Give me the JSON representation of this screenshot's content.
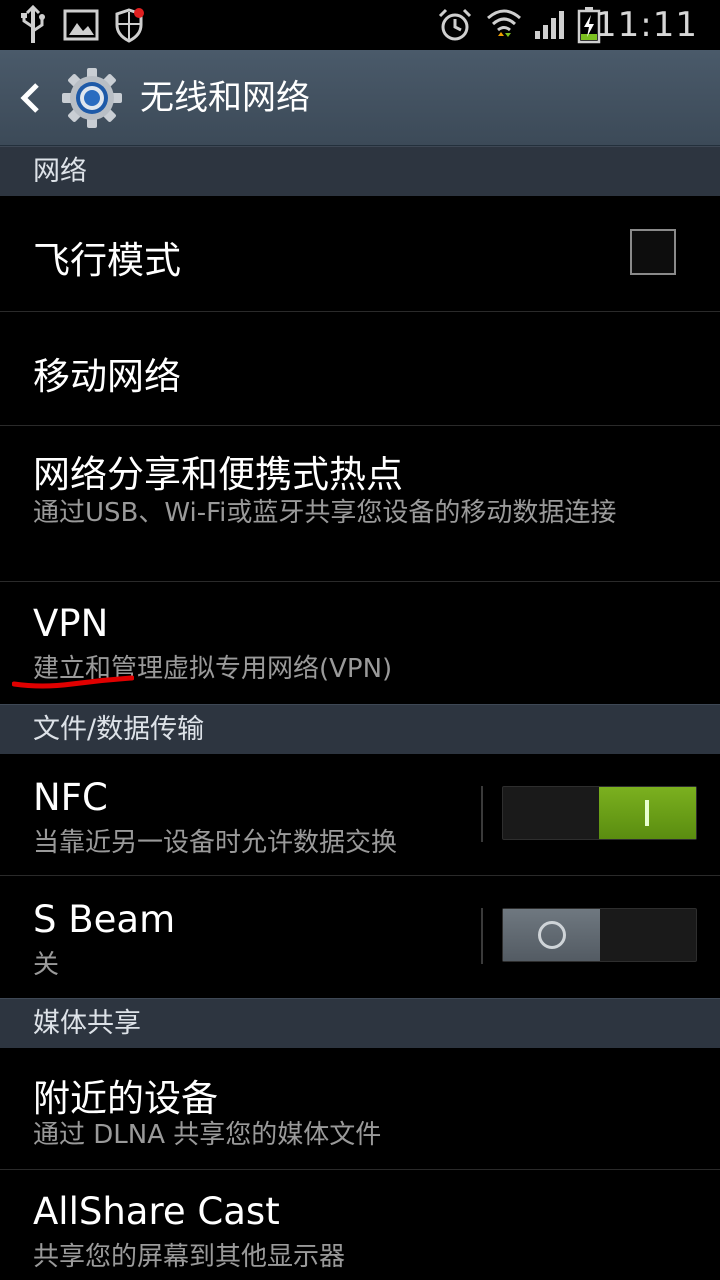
{
  "status_bar": {
    "time": "11:11",
    "icons": [
      "usb-icon",
      "image-icon",
      "shield-icon",
      "alarm-icon",
      "wifi-icon",
      "signal-icon",
      "battery-charging-icon"
    ]
  },
  "action_bar": {
    "title": "无线和网络"
  },
  "sections": {
    "network": "网络",
    "file_transfer": "文件/数据传输",
    "media_share": "媒体共享"
  },
  "items": {
    "airplane": {
      "title": "飞行模式",
      "checked": false
    },
    "mobile_network": {
      "title": "移动网络"
    },
    "tethering": {
      "title": "网络分享和便携式热点",
      "subtitle": "通过USB、Wi-Fi或蓝牙共享您设备的移动数据连接"
    },
    "vpn": {
      "title": "VPN",
      "subtitle": "建立和管理虚拟专用网络(VPN)"
    },
    "nfc": {
      "title": "NFC",
      "subtitle": "当靠近另一设备时允许数据交换",
      "enabled": true
    },
    "sbeam": {
      "title": "S Beam",
      "subtitle": "关",
      "enabled": false
    },
    "nearby": {
      "title": "附近的设备",
      "subtitle": "通过 DLNA 共享您的媒体文件"
    },
    "allshare": {
      "title": "AllShare Cast",
      "subtitle": "共享您的屏幕到其他显示器"
    }
  },
  "colors": {
    "section_bg": "#2d3540",
    "toggle_on": "#6a9e18",
    "annotation": "#e00000"
  }
}
